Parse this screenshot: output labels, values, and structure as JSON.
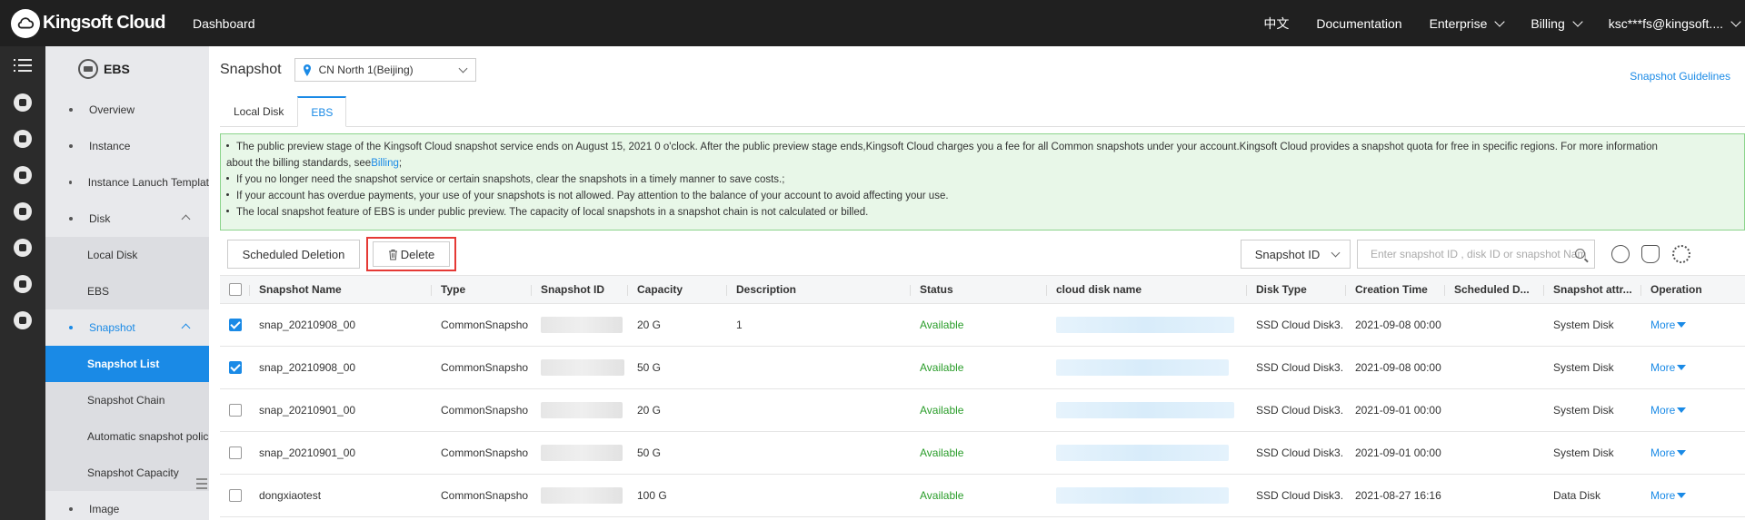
{
  "topbar": {
    "brand": "Kingsoft Cloud",
    "dashboard": "Dashboard",
    "language": "中文",
    "documentation": "Documentation",
    "enterprise": "Enterprise",
    "billing": "Billing",
    "account": "ksc***fs@kingsoft...."
  },
  "sidebar": {
    "header": "EBS",
    "items": [
      {
        "label": "Overview"
      },
      {
        "label": "Instance"
      },
      {
        "label": "Instance Lanuch Templat"
      },
      {
        "label": "Disk"
      }
    ],
    "disk_sub": [
      {
        "label": "Local Disk"
      },
      {
        "label": "EBS"
      }
    ],
    "snapshot": {
      "label": "Snapshot"
    },
    "snapshot_sub": [
      {
        "label": "Snapshot List"
      },
      {
        "label": "Snapshot Chain"
      },
      {
        "label": "Automatic snapshot polic"
      },
      {
        "label": "Snapshot Capacity"
      }
    ],
    "image": {
      "label": "Image"
    }
  },
  "page": {
    "title": "Snapshot",
    "region": "CN North 1(Beijing)",
    "guidelines": "Snapshot Guidelines"
  },
  "tabs": [
    {
      "label": "Local Disk"
    },
    {
      "label": "EBS"
    }
  ],
  "notice": {
    "line1": "The public preview stage of the Kingsoft Cloud snapshot service ends on August 15, 2021 0 o'clock. After the public preview stage ends,Kingsoft Cloud charges you a fee for all Common snapshots under your account.Kingsoft Cloud provides a snapshot quota for free in specific regions. For more information",
    "line1b": "about the billing standards, see",
    "billing_link": "Billing",
    "line1c": ";",
    "line2": "If you no longer need the snapshot service or certain snapshots, clear the snapshots in a timely manner to save costs.;",
    "line3": "If your account has overdue payments, your use of your snapshots is not allowed. Pay attention to the balance of your account to avoid affecting your use.",
    "line4": "The local snapshot feature of EBS is under public preview. The capacity of local snapshots in a snapshot chain is not calculated or billed."
  },
  "toolbar": {
    "scheduled_deletion": "Scheduled Deletion",
    "delete": "Delete",
    "filter_select": "Snapshot ID",
    "search_placeholder": "Enter snapshot ID , disk ID or snapshot Nam"
  },
  "table": {
    "headers": {
      "name": "Snapshot Name",
      "type": "Type",
      "id": "Snapshot ID",
      "capacity": "Capacity",
      "description": "Description",
      "status": "Status",
      "disk_name": "cloud disk name",
      "disk_type": "Disk Type",
      "creation_time": "Creation Time",
      "scheduled": "Scheduled D...",
      "attr": "Snapshot attr...",
      "operation": "Operation"
    },
    "rows": [
      {
        "checked": true,
        "name": "snap_20210908_00",
        "type": "CommonSnapsho",
        "capacity": "20 G",
        "description": "1",
        "status": "Available",
        "disk_type": "SSD Cloud Disk3.",
        "creation_time": "2021-09-08 00:00",
        "scheduled": "",
        "attr": "System Disk",
        "op": "More"
      },
      {
        "checked": true,
        "name": "snap_20210908_00",
        "type": "CommonSnapsho",
        "capacity": "50 G",
        "description": "",
        "status": "Available",
        "disk_type": "SSD Cloud Disk3.",
        "creation_time": "2021-09-08 00:00",
        "scheduled": "",
        "attr": "System Disk",
        "op": "More"
      },
      {
        "checked": false,
        "name": "snap_20210901_00",
        "type": "CommonSnapsho",
        "capacity": "20 G",
        "description": "",
        "status": "Available",
        "disk_type": "SSD Cloud Disk3.",
        "creation_time": "2021-09-01 00:00",
        "scheduled": "",
        "attr": "System Disk",
        "op": "More"
      },
      {
        "checked": false,
        "name": "snap_20210901_00",
        "type": "CommonSnapsho",
        "capacity": "50 G",
        "description": "",
        "status": "Available",
        "disk_type": "SSD Cloud Disk3.",
        "creation_time": "2021-09-01 00:00",
        "scheduled": "",
        "attr": "System Disk",
        "op": "More"
      },
      {
        "checked": false,
        "name": "dongxiaotest",
        "type": "CommonSnapsho",
        "capacity": "100 G",
        "description": "",
        "status": "Available",
        "disk_type": "SSD Cloud Disk3.",
        "creation_time": "2021-08-27 16:16",
        "scheduled": "",
        "attr": "Data Disk",
        "op": "More"
      }
    ]
  },
  "colors": {
    "accent": "#1a8ae6",
    "topbar": "#202020",
    "status_ok": "#2a9d2a",
    "notice_bg": "#e8f7e8",
    "highlight_box": "#e53935"
  }
}
